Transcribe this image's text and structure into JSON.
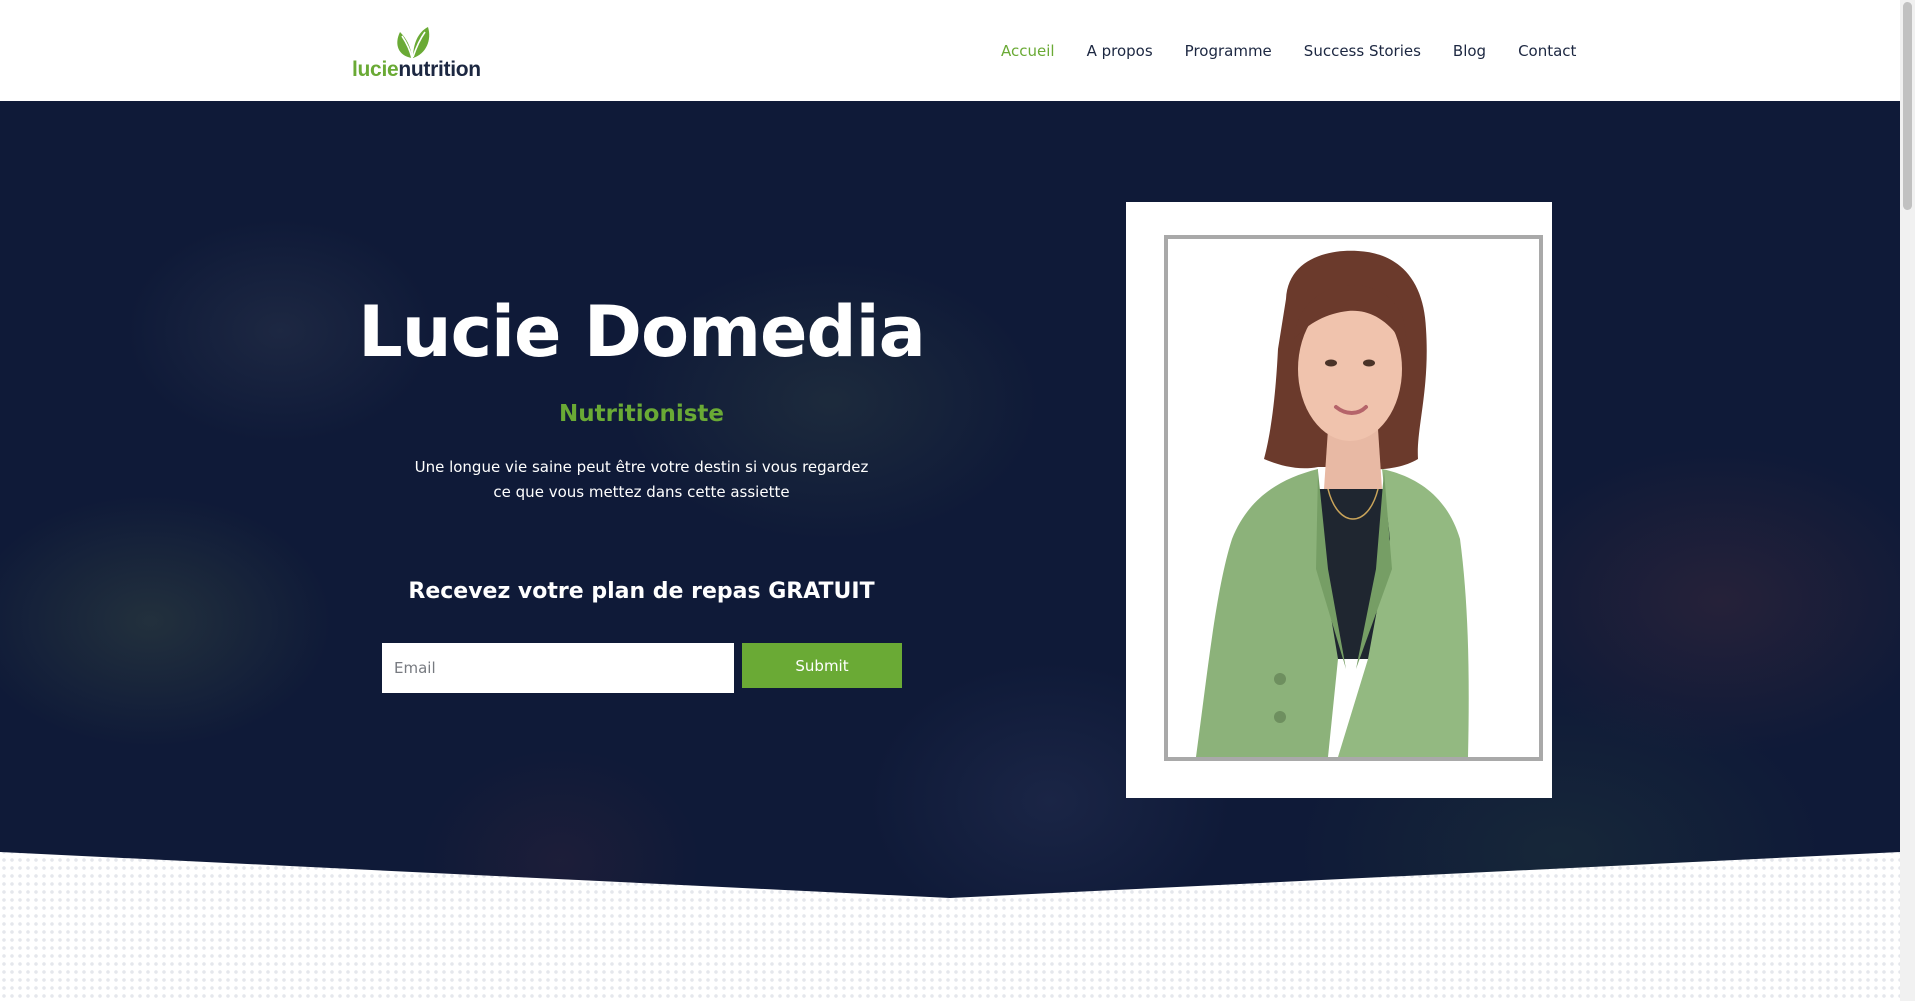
{
  "header": {
    "logo_part1": "lucie",
    "logo_part2": "nutrition",
    "logo_icon": "leaf-icon",
    "nav": [
      {
        "label": "Accueil",
        "active": true
      },
      {
        "label": "A propos",
        "active": false
      },
      {
        "label": "Programme",
        "active": false
      },
      {
        "label": "Success Stories",
        "active": false
      },
      {
        "label": "Blog",
        "active": false
      },
      {
        "label": "Contact",
        "active": false
      }
    ]
  },
  "hero": {
    "title": "Lucie Domedia",
    "subtitle": "Nutritioniste",
    "text": "Une longue vie saine peut être votre destin si vous regardez ce que vous mettez dans cette assiette",
    "cta_heading": "Recevez votre plan de repas GRATUIT",
    "email_placeholder": "Email",
    "email_value": "",
    "submit_label": "Submit"
  },
  "colors": {
    "accent": "#6aaa35",
    "navy": "#0f1a38",
    "text_dark": "#1c2741"
  }
}
